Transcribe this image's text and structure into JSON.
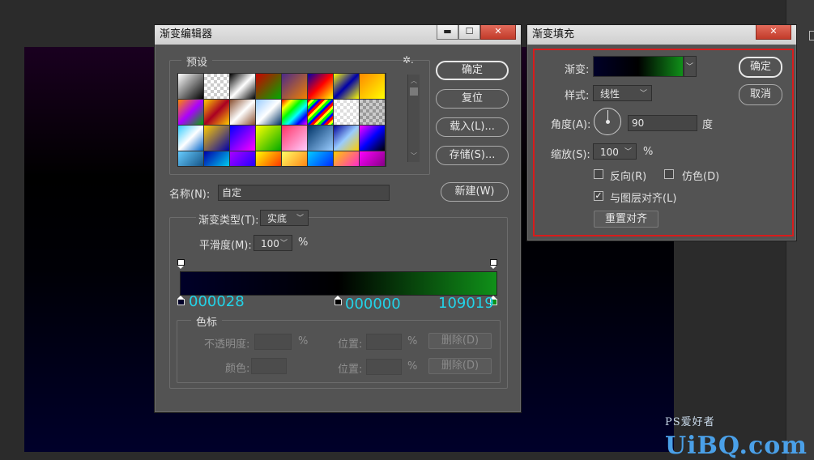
{
  "editor": {
    "title": "渐变编辑器",
    "win_min": "▬",
    "win_max": "☐",
    "win_close": "✕",
    "presets_label": "预设",
    "gear": "✲.",
    "ok": "确定",
    "reset": "复位",
    "load": "载入(L)...",
    "save": "存储(S)...",
    "name_label": "名称(N):",
    "name_value": "自定",
    "new": "新建(W)",
    "type_label": "渐变类型(T):",
    "type_value": "实底",
    "smooth_label": "平滑度(M):",
    "smooth_value": "100",
    "percent": "%",
    "stop_left": "000028",
    "stop_mid": "000000",
    "stop_right": "109019",
    "stops_group": "色标",
    "opacity_label": "不透明度:",
    "position_label": "位置:",
    "delete": "删除(D)",
    "color_label": "颜色:",
    "gradient_colors": [
      "#000028",
      "#000000",
      "#109019"
    ]
  },
  "presets": [
    "linear-gradient(135deg,#fff,#000)",
    "repeating-conic-gradient(#ccc 0 25%,#fff 0 50%) 0 0/8px 8px",
    "linear-gradient(135deg,#000,#fff,#000)",
    "linear-gradient(135deg,#c00,#0a0)",
    "linear-gradient(135deg,#4a2a8a,#f08000)",
    "linear-gradient(135deg,#00a,#f00,#ff0)",
    "linear-gradient(135deg,#ff0,#00a,#ff0)",
    "linear-gradient(135deg,#f80,#ff0)",
    "linear-gradient(135deg,#f80,#a0f,#0a0)",
    "linear-gradient(135deg,#fc0,#a02,#fc0)",
    "linear-gradient(135deg,#8a5030,#fff,#8a5030)",
    "linear-gradient(135deg,#9cf,#fff,#036)",
    "linear-gradient(135deg,#f00,#ff0,#0f0,#0ff,#00f,#f0f)",
    "repeating-linear-gradient(135deg,#f00 0 3px,#ff0 3px 6px,#0f0 6px 9px,#00f 9px 12px)",
    "repeating-conic-gradient(#ddd 0 25%,#fff 0 50%) 0 0/8px 8px",
    "repeating-conic-gradient(#999 0 25%,#ccc 0 50%) 0 0/8px 8px",
    "linear-gradient(135deg,#3cf,#fff,#06c)",
    "linear-gradient(135deg,#fc0,#00a)",
    "linear-gradient(135deg,#00f,#f0f)",
    "linear-gradient(135deg,#ff0,#0a0)",
    "linear-gradient(135deg,#f36,#fcf)",
    "linear-gradient(135deg,#036,#9cf)",
    "linear-gradient(135deg,#009,#9cf,#fc0)",
    "linear-gradient(135deg,#f0f,#00f,#000)",
    "linear-gradient(135deg,#6cf,#036)",
    "linear-gradient(135deg,#00a,#0ff)",
    "linear-gradient(135deg,#a0f,#00f)",
    "linear-gradient(135deg,#ff0,#f00)",
    "linear-gradient(135deg,#ff6,#f60)",
    "linear-gradient(135deg,#0cf,#00f)",
    "linear-gradient(135deg,#fc0,#f0f)",
    "linear-gradient(135deg,#f0f,#606)"
  ],
  "fill": {
    "title": "渐变填充",
    "win_close": "✕",
    "gradient_label": "渐变:",
    "style_label": "样式:",
    "style_value": "线性",
    "angle_label": "角度(A):",
    "angle_value": "90",
    "angle_unit": "度",
    "scale_label": "缩放(S):",
    "scale_value": "100",
    "percent": "%",
    "reverse_label": "反向(R)",
    "reverse_checked": false,
    "dither_label": "仿色(D)",
    "dither_checked": false,
    "align_label": "与图层对齐(L)",
    "align_checked": true,
    "reset_align": "重置对齐",
    "ok": "确定",
    "cancel": "取消",
    "check_mark": "✓"
  },
  "watermark": {
    "brand": "UiBQ.com",
    "ps": "PS",
    "cn": "爱好者"
  },
  "highlight_color": "#d81c1c"
}
